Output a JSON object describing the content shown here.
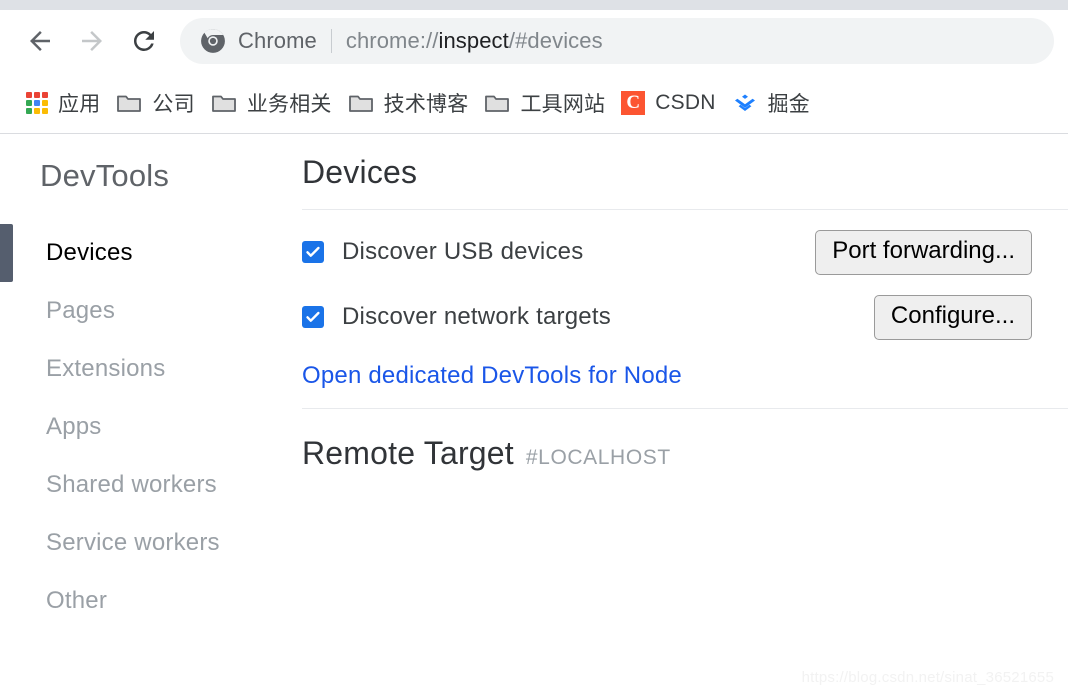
{
  "browser": {
    "nav": {
      "back_label": "Back",
      "forward_label": "Forward",
      "reload_label": "Reload"
    },
    "omnibox": {
      "chip_icon": "chrome-logo-icon",
      "chip_label": "Chrome",
      "url_prefix": "chrome://",
      "url_highlight": "inspect",
      "url_suffix": "/#devices",
      "full_url": "chrome://inspect/#devices"
    },
    "bookmarks": [
      {
        "label": "应用",
        "icon": "apps-grid-icon"
      },
      {
        "label": "公司",
        "icon": "folder-icon"
      },
      {
        "label": "业务相关",
        "icon": "folder-icon"
      },
      {
        "label": "技术博客",
        "icon": "folder-icon"
      },
      {
        "label": "工具网站",
        "icon": "folder-icon"
      },
      {
        "label": "CSDN",
        "icon": "csdn-icon"
      },
      {
        "label": "掘金",
        "icon": "juejin-icon"
      }
    ]
  },
  "devtools": {
    "title": "DevTools",
    "nav_items": [
      {
        "label": "Devices",
        "selected": true
      },
      {
        "label": "Pages",
        "selected": false
      },
      {
        "label": "Extensions",
        "selected": false
      },
      {
        "label": "Apps",
        "selected": false
      },
      {
        "label": "Shared workers",
        "selected": false
      },
      {
        "label": "Service workers",
        "selected": false
      },
      {
        "label": "Other",
        "selected": false
      }
    ],
    "main": {
      "heading": "Devices",
      "options": [
        {
          "label": "Discover USB devices",
          "checked": true,
          "button": "Port forwarding..."
        },
        {
          "label": "Discover network targets",
          "checked": true,
          "button": "Configure..."
        }
      ],
      "node_link": "Open dedicated DevTools for Node",
      "remote_target_title": "Remote Target",
      "remote_target_subtitle": "#LOCALHOST"
    }
  },
  "watermark": "https://blog.csdn.net/sinat_36521655",
  "colors": {
    "accent_blue": "#1a73e8",
    "link_blue": "#1a56e8",
    "selection_bar": "#555e6e",
    "csdn_orange": "#fc5531",
    "juejin_blue": "#1e80ff",
    "text_primary": "#3c4043",
    "text_muted": "#9aa0a6"
  }
}
